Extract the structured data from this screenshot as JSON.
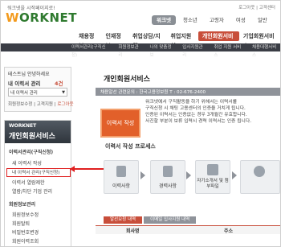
{
  "header": {
    "tagline": "워크넷을 시작페이지로!",
    "util_links": [
      "로그아웃",
      "고객센터"
    ],
    "logo_text": "ORKNET",
    "logo_initial": "W",
    "top_tabs": [
      "워크넷",
      "청소년",
      "고령자",
      "여성",
      "일반"
    ],
    "active_top_tab": "워크넷"
  },
  "main_nav": {
    "items": [
      "채용정보",
      "인재정보",
      "취업상담/지원",
      "취업지원실",
      "개인회원서비스",
      "기업회원서비스"
    ]
  },
  "sub_nav": {
    "items": [
      "이력서관리(구직신청)",
      "회원정보관리",
      "나의 맞춤정보",
      "입사지원관리",
      "취업 지원 서비스",
      "채용대행서비스"
    ]
  },
  "login": {
    "greeting": "테스트님 안녕하세요",
    "label": "내 이력서 관리",
    "count": "4건",
    "resume_select": "내 이력서 관리",
    "links": [
      "회원정보수정",
      "고객지원",
      "로그아웃"
    ]
  },
  "sidebar": {
    "brand": "WORKNET",
    "title": "개인회원서비스",
    "section1": "이력서관리(구직신청)",
    "items1": [
      "새 이력서 작성",
      "내 이력서 관리(구직신청)",
      "이력서 열람제한",
      "열람/차단 기업 관리"
    ],
    "section2": "회원정보관리",
    "items2": [
      "회원정보수정",
      "회원탈퇴",
      "비밀번호변경",
      "회원이력조회"
    ]
  },
  "callout": {
    "label": "클릭"
  },
  "content": {
    "title": "개인회원서비스",
    "bread": "채용알선 관련문의 : 한국고용정보원  T : 02-676-2400",
    "big_button": "이력서 작성",
    "desc_lines": [
      "워크넷에서 구직활동을 하기 위해서는 이력서를",
      "구직신청 시 채팅 고용센터의 인증을 거치게 됩니다.",
      "인증된 이력서는 인증없는 경우 3개월간 유효합니다.",
      "사진할 부분이 보류 입력시 경력 이력서는 인증 됩니다."
    ],
    "steps_title": "이력서 작성 프로세스",
    "steps": [
      "이력사항",
      "경력사항",
      "자기소개서 및 첨부파일",
      ""
    ],
    "tabs": [
      "알선요청 내역",
      "이메일 입사지원 내역"
    ],
    "table_headers": [
      "회사명",
      "",
      "주소"
    ]
  },
  "colors": {
    "accent": "#c84e3a",
    "nav_dark": "#3a3d45",
    "orange": "#e2602a",
    "callout": "#e02020",
    "logo_green": "#2f7a2f"
  }
}
